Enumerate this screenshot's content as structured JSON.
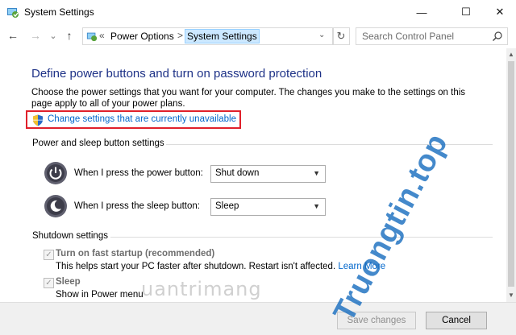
{
  "window": {
    "title": "System Settings",
    "controls": {
      "minimize": "—",
      "maximize": "☐",
      "close": "✕"
    }
  },
  "navbar": {
    "back": "←",
    "forward": "→",
    "recent": "⌄",
    "up": "↑",
    "address_prefix": "«",
    "breadcrumb": [
      "Power Options",
      "System Settings"
    ],
    "breadcrumb_separator": ">",
    "dropdown": "⌄",
    "refresh": "↻",
    "search_placeholder": "Search Control Panel"
  },
  "main": {
    "heading": "Define power buttons and turn on password protection",
    "description": "Choose the power settings that you want for your computer. The changes you make to the settings on this page apply to all of your power plans.",
    "change_link": "Change settings that are currently unavailable",
    "power_sleep_section": {
      "title": "Power and sleep button settings",
      "rows": [
        {
          "label": "When I press the power button:",
          "value": "Shut down"
        },
        {
          "label": "When I press the sleep button:",
          "value": "Sleep"
        }
      ]
    },
    "shutdown_section": {
      "title": "Shutdown settings",
      "fast_startup": {
        "label": "Turn on fast startup (recommended)",
        "description": "This helps start your PC faster after shutdown. Restart isn't affected.",
        "learn_more": "Learn More",
        "checked": true
      },
      "sleep": {
        "label": "Sleep",
        "description": "Show in Power menu",
        "checked": true
      }
    }
  },
  "footer": {
    "save_label": "Save changes",
    "cancel_label": "Cancel"
  },
  "watermarks": {
    "left": "uantrimang",
    "right": "Truongtin.top"
  },
  "colors": {
    "heading": "#1e3287",
    "link": "#0066cc",
    "highlight_box": "#e0202a",
    "watermark_right": "#1b6fc0",
    "watermark_dot": "#e85b2a"
  }
}
